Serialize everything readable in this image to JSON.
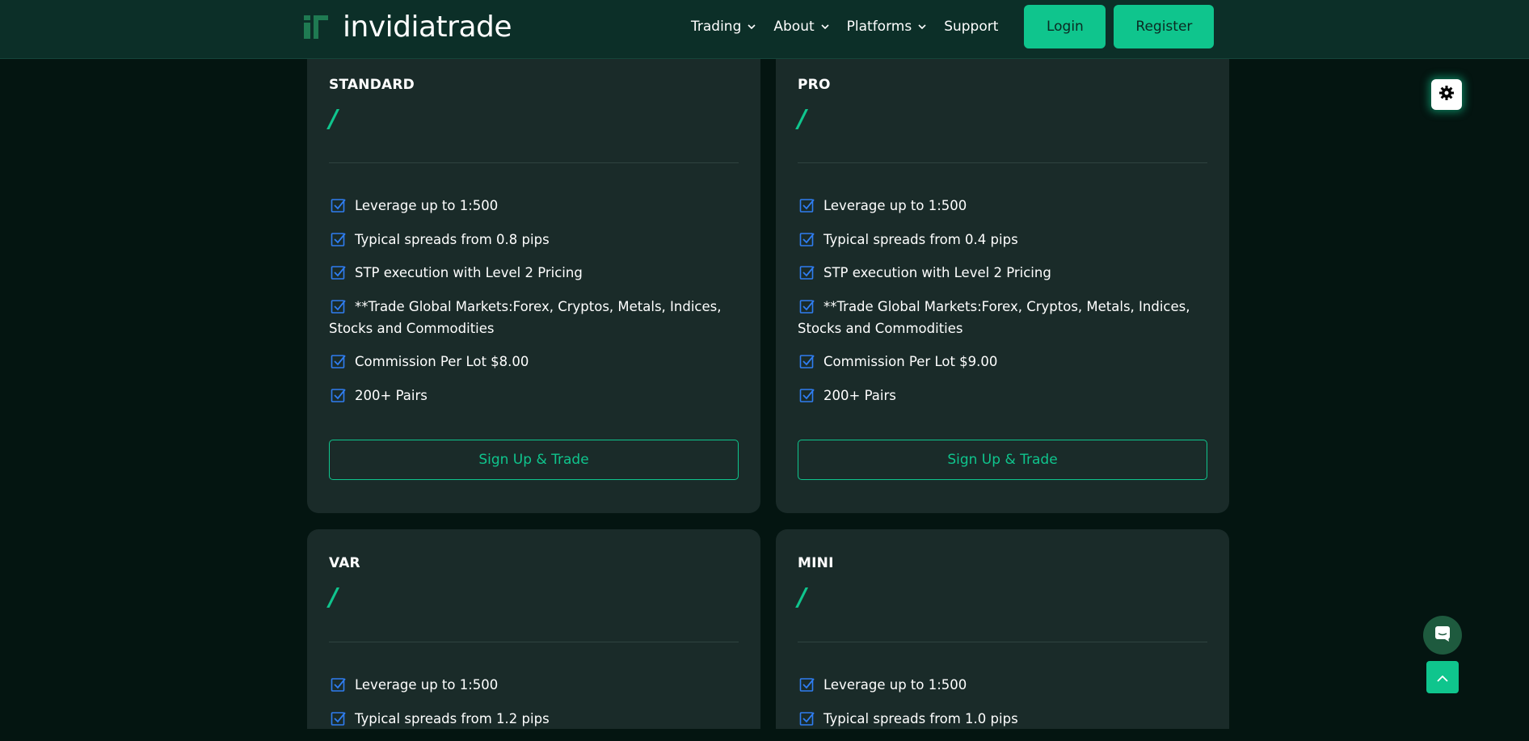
{
  "header": {
    "logo_text": "invidiatrade",
    "nav": [
      {
        "label": "Trading",
        "has_dropdown": true
      },
      {
        "label": "About",
        "has_dropdown": true
      },
      {
        "label": "Platforms",
        "has_dropdown": true
      },
      {
        "label": "Support",
        "has_dropdown": false
      }
    ],
    "login_label": "Login",
    "register_label": "Register"
  },
  "cards": [
    {
      "title": "STANDARD",
      "price": "/",
      "features": [
        "Leverage up to 1:500",
        "Typical spreads from 0.8 pips",
        "STP execution with Level 2 Pricing",
        "**Trade Global Markets:Forex, Cryptos, Metals, Indices, Stocks and Commodities",
        "Commission Per Lot $8.00",
        "200+ Pairs"
      ],
      "cta": "Sign Up & Trade"
    },
    {
      "title": "PRO",
      "price": "/",
      "features": [
        "Leverage up to 1:500",
        "Typical spreads from 0.4 pips",
        "STP execution with Level 2 Pricing",
        "**Trade Global Markets:Forex, Cryptos, Metals, Indices, Stocks and Commodities",
        "Commission Per Lot $9.00",
        "200+ Pairs"
      ],
      "cta": "Sign Up & Trade"
    },
    {
      "title": "VAR",
      "price": "/",
      "features": [
        "Leverage up to 1:500",
        "Typical spreads from 1.2 pips"
      ]
    },
    {
      "title": "MINI",
      "price": "/",
      "features": [
        "Leverage up to 1:500",
        "Typical spreads from 1.0 pips"
      ]
    }
  ],
  "widgets": {
    "theme_toggle_icon": "gear-icon",
    "chat_icon": "chat-icon",
    "back_to_top_icon": "chevron-up-icon"
  },
  "colors": {
    "accent": "#0fc58d",
    "header_bg": "#0c2f28",
    "page_bg": "#041511",
    "card_bg": "#1a2b29",
    "check_icon": "#2f7df0"
  }
}
